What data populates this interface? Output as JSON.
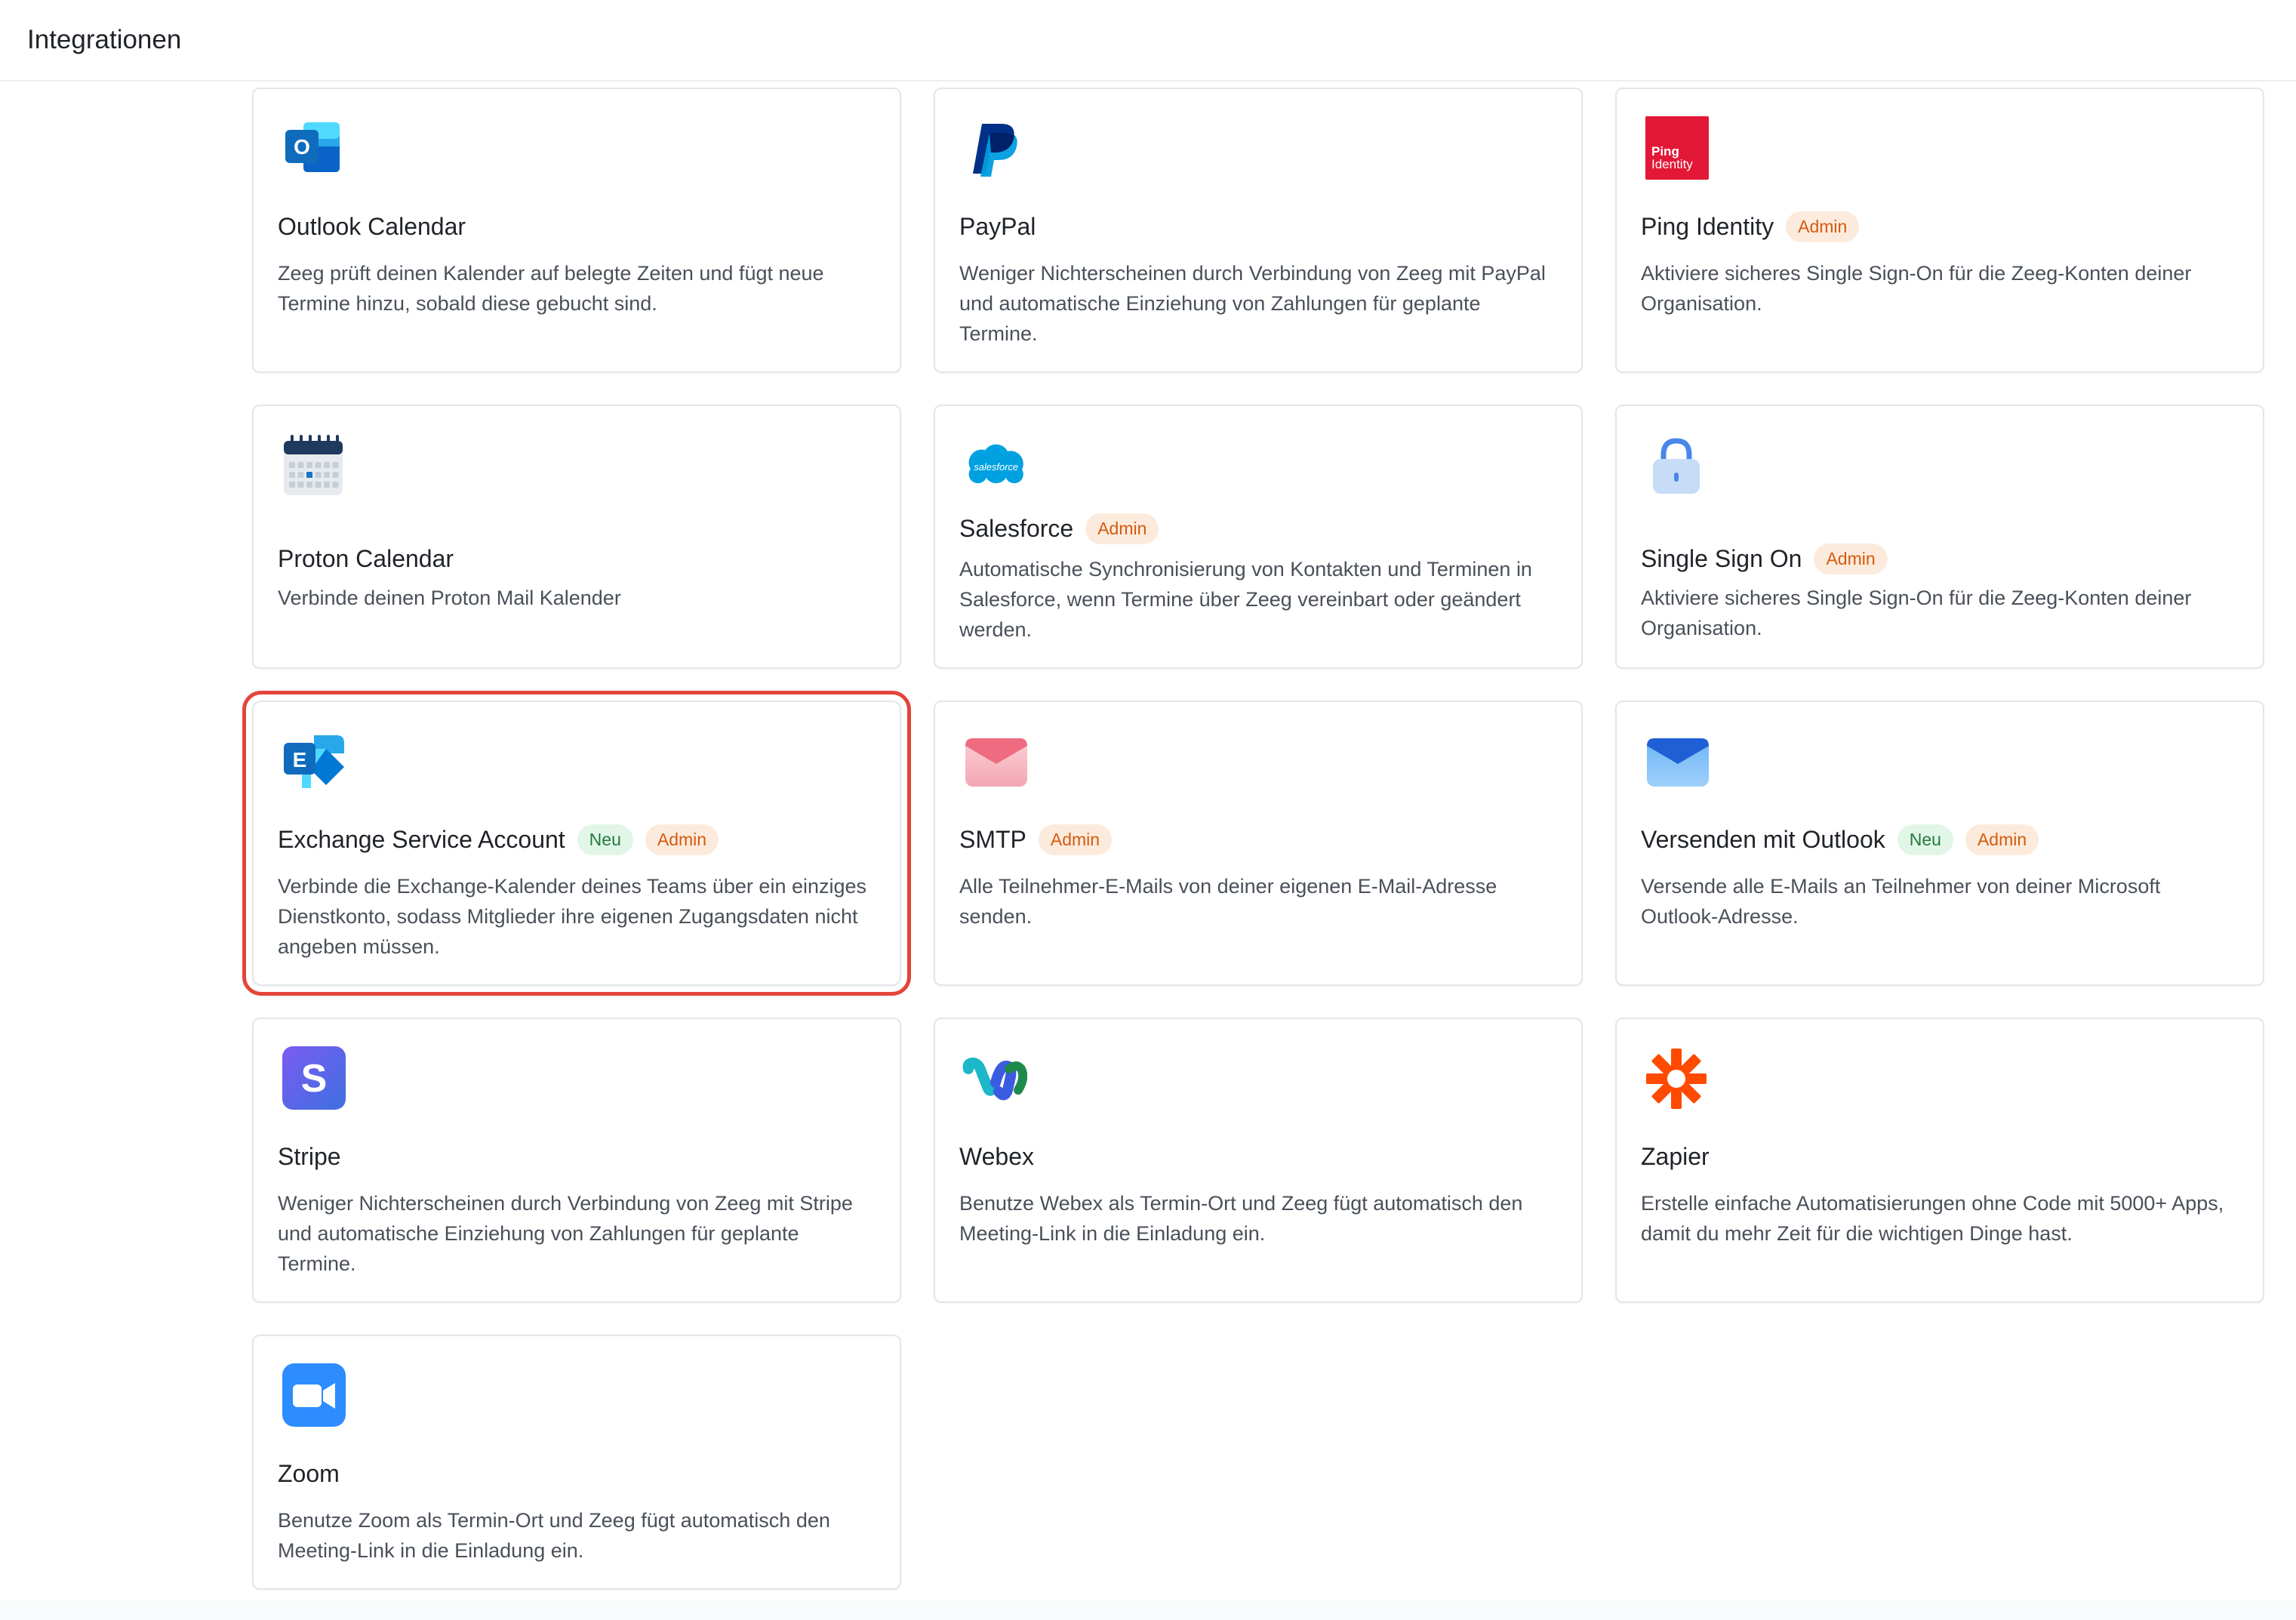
{
  "header": {
    "title": "Integrationen"
  },
  "colors": {
    "admin_badge_bg": "#fcebdc",
    "admin_badge_text": "#d55a10",
    "new_badge_bg": "#e2f6e8",
    "new_badge_text": "#237a3e",
    "highlight": "#e3453a"
  },
  "integrations": [
    {
      "name": "Outlook Calendar",
      "icon": "outlook-icon",
      "badges": [],
      "description": "Zeeg prüft deinen Kalender auf belegte Zeiten und fügt neue Termine hinzu, sobald diese gebucht sind."
    },
    {
      "name": "PayPal",
      "icon": "paypal-icon",
      "badges": [],
      "description": "Weniger Nichterscheinen durch Verbindung von Zeeg mit PayPal und automatische Einziehung von Zahlungen für geplante Termine."
    },
    {
      "name": "Ping Identity",
      "icon": "ping-identity-icon",
      "icon_text": [
        "Ping",
        "Identity"
      ],
      "badges": [
        "Admin"
      ],
      "description": "Aktiviere sicheres Single Sign-On für die Zeeg-Konten deiner Organisation."
    },
    {
      "name": "Proton Calendar",
      "icon": "calendar-icon",
      "badges": [],
      "description": "Verbinde deinen Proton Mail Kalender"
    },
    {
      "name": "Salesforce",
      "icon": "salesforce-icon",
      "icon_text": "salesforce",
      "badges": [
        "Admin"
      ],
      "description": "Automatische Synchronisierung von Kontakten und Terminen in Salesforce, wenn Termine über Zeeg vereinbart oder geändert werden."
    },
    {
      "name": "Single Sign On",
      "icon": "lock-icon",
      "badges": [
        "Admin"
      ],
      "description": "Aktiviere sicheres Single Sign-On für die Zeeg-Konten deiner Organisation."
    },
    {
      "name": "Exchange Service Account",
      "icon": "exchange-icon",
      "badges": [
        "Neu",
        "Admin"
      ],
      "highlighted": true,
      "description": "Verbinde die Exchange-Kalender deines Teams über ein einziges Dienstkonto, sodass Mitglieder ihre eigenen Zugangsdaten nicht angeben müssen."
    },
    {
      "name": "SMTP",
      "icon": "envelope-pink-icon",
      "badges": [
        "Admin"
      ],
      "description": "Alle Teilnehmer-E-Mails von deiner eigenen E-Mail-Adresse senden."
    },
    {
      "name": "Versenden mit Outlook",
      "icon": "envelope-blue-icon",
      "badges": [
        "Neu",
        "Admin"
      ],
      "description": "Versende alle E-Mails an Teilnehmer von deiner Microsoft Outlook-Adresse."
    },
    {
      "name": "Stripe",
      "icon": "stripe-icon",
      "badges": [],
      "description": "Weniger Nichterscheinen durch Verbindung von Zeeg mit Stripe und automatische Einziehung von Zahlungen für geplante Termine."
    },
    {
      "name": "Webex",
      "icon": "webex-icon",
      "badges": [],
      "description": "Benutze Webex als Termin-Ort und Zeeg fügt automatisch den Meeting-Link in die Einladung ein."
    },
    {
      "name": "Zapier",
      "icon": "zapier-icon",
      "badges": [],
      "description": "Erstelle einfache Automatisierungen ohne Code mit 5000+ Apps, damit du mehr Zeit für die wichtigen Dinge hast."
    },
    {
      "name": "Zoom",
      "icon": "zoom-icon",
      "badges": [],
      "description": "Benutze Zoom als Termin-Ort und Zeeg fügt automatisch den Meeting-Link in die Einladung ein."
    }
  ]
}
